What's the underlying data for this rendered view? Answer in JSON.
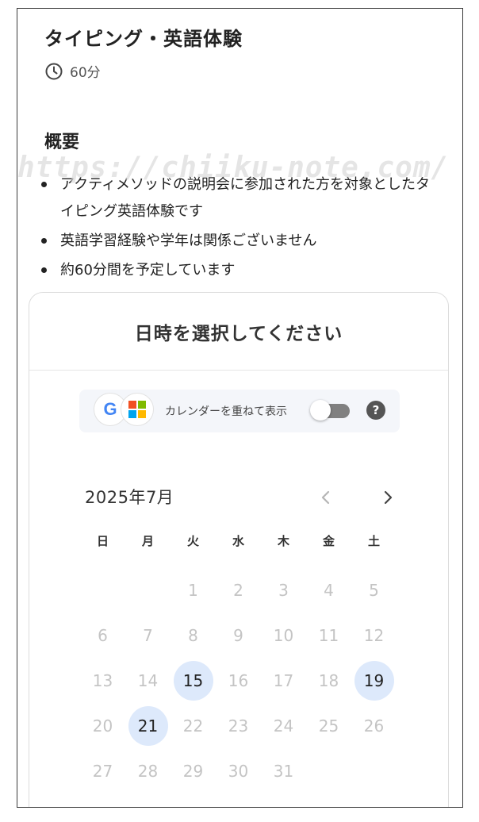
{
  "event": {
    "title": "タイピング・英語体験",
    "duration": "60分"
  },
  "overview": {
    "heading": "概要",
    "bullets": [
      "アクティメソッドの説明会に参加された方を対象としたタイピング英語体験です",
      "英語学習経験や学年は関係ございません",
      "約60分間を予定しています"
    ]
  },
  "watermark": "https://chiiku-note.com/",
  "scheduler": {
    "heading": "日時を選択してください",
    "calendar_overlay_label": "カレンダーを重ねて表示",
    "help_symbol": "?",
    "google_letter": "G",
    "month_label": "2025年7月",
    "weekdays": [
      "日",
      "月",
      "火",
      "水",
      "木",
      "金",
      "土"
    ],
    "days": [
      {
        "label": ""
      },
      {
        "label": ""
      },
      {
        "label": "1"
      },
      {
        "label": "2"
      },
      {
        "label": "3"
      },
      {
        "label": "4"
      },
      {
        "label": "5"
      },
      {
        "label": "6"
      },
      {
        "label": "7"
      },
      {
        "label": "8"
      },
      {
        "label": "9"
      },
      {
        "label": "10"
      },
      {
        "label": "11"
      },
      {
        "label": "12"
      },
      {
        "label": "13"
      },
      {
        "label": "14"
      },
      {
        "label": "15",
        "available": true
      },
      {
        "label": "16"
      },
      {
        "label": "17"
      },
      {
        "label": "18"
      },
      {
        "label": "19",
        "available": true
      },
      {
        "label": "20"
      },
      {
        "label": "21",
        "available": true
      },
      {
        "label": "22"
      },
      {
        "label": "23"
      },
      {
        "label": "24"
      },
      {
        "label": "25"
      },
      {
        "label": "26"
      },
      {
        "label": "27"
      },
      {
        "label": "28"
      },
      {
        "label": "29"
      },
      {
        "label": "30"
      },
      {
        "label": "31"
      }
    ]
  },
  "colors": {
    "available_day_bg": "#dde9fb",
    "unavailable_day_text": "#c4c4c4",
    "ms_red": "#F25022",
    "ms_green": "#7FBA00",
    "ms_blue": "#00A4EF",
    "ms_yellow": "#FFB900"
  },
  "icons": {
    "duration": "clock-icon",
    "prev": "chevron-left-icon",
    "next": "chevron-right-icon",
    "help": "help-icon"
  }
}
